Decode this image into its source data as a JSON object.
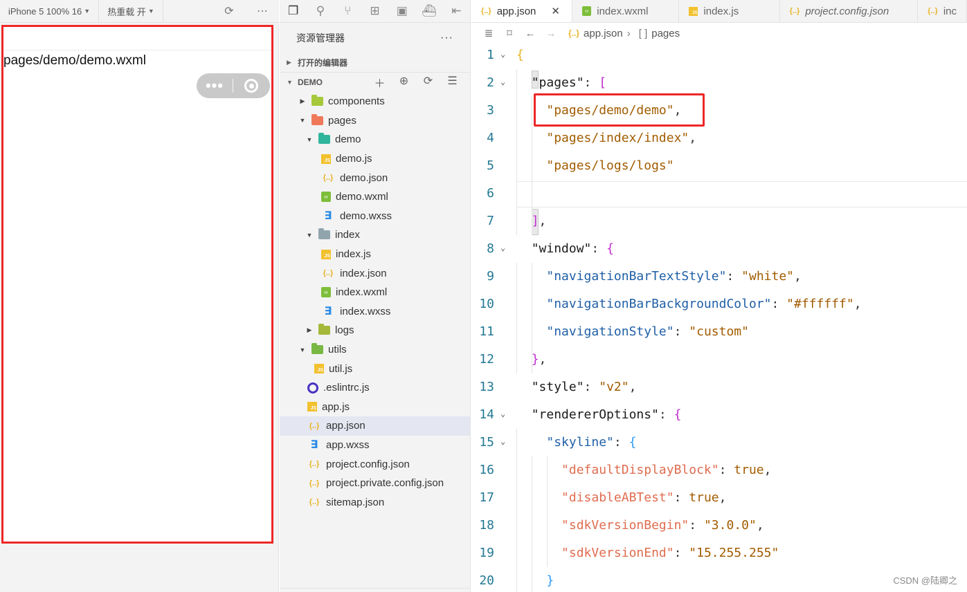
{
  "simulator": {
    "device_label": "iPhone 5 100% 16",
    "hot_reload_label": "热重载 开",
    "page_path": "pages/demo/demo.wxml"
  },
  "explorer": {
    "title": "资源管理器",
    "open_editors": "打开的编辑器",
    "project": "DEMO",
    "tree": [
      {
        "label": "components",
        "type": "folder",
        "depth": 1,
        "expanded": false,
        "color": "#a5c93a"
      },
      {
        "label": "pages",
        "type": "folder",
        "depth": 1,
        "expanded": true,
        "color": "#f0795a"
      },
      {
        "label": "demo",
        "type": "folder",
        "depth": 2,
        "expanded": true,
        "color": "#2fb59b"
      },
      {
        "label": "demo.js",
        "type": "js",
        "depth": 3
      },
      {
        "label": "demo.json",
        "type": "json",
        "depth": 3
      },
      {
        "label": "demo.wxml",
        "type": "wxml",
        "depth": 3
      },
      {
        "label": "demo.wxss",
        "type": "wxss",
        "depth": 3
      },
      {
        "label": "index",
        "type": "folder",
        "depth": 2,
        "expanded": true,
        "color": "#90a4ae"
      },
      {
        "label": "index.js",
        "type": "js",
        "depth": 3
      },
      {
        "label": "index.json",
        "type": "json",
        "depth": 3
      },
      {
        "label": "index.wxml",
        "type": "wxml",
        "depth": 3
      },
      {
        "label": "index.wxss",
        "type": "wxss",
        "depth": 3
      },
      {
        "label": "logs",
        "type": "folder",
        "depth": 2,
        "expanded": false,
        "color": "#a5b83a"
      },
      {
        "label": "utils",
        "type": "folder",
        "depth": 1,
        "expanded": true,
        "color": "#78b843"
      },
      {
        "label": "util.js",
        "type": "js",
        "depth": 2
      },
      {
        "label": ".eslintrc.js",
        "type": "eslint",
        "depth": 1
      },
      {
        "label": "app.js",
        "type": "js",
        "depth": 1
      },
      {
        "label": "app.json",
        "type": "json",
        "depth": 1,
        "selected": true
      },
      {
        "label": "app.wxss",
        "type": "wxss",
        "depth": 1
      },
      {
        "label": "project.config.json",
        "type": "json",
        "depth": 1
      },
      {
        "label": "project.private.config.json",
        "type": "json",
        "depth": 1
      },
      {
        "label": "sitemap.json",
        "type": "json",
        "depth": 1
      }
    ]
  },
  "editor": {
    "tabs": [
      {
        "label": "app.json",
        "icon": "json",
        "active": true,
        "close": "✕"
      },
      {
        "label": "index.wxml",
        "icon": "wxml"
      },
      {
        "label": "index.js",
        "icon": "js"
      },
      {
        "label": "project.config.json",
        "icon": "json",
        "italic": true
      },
      {
        "label": "inc",
        "icon": "json"
      }
    ],
    "breadcrumb": {
      "file": "app.json",
      "node": "pages"
    },
    "lines": [
      {
        "n": "1",
        "fold": true,
        "segs": [
          [
            "b1",
            "{"
          ]
        ]
      },
      {
        "n": "2",
        "fold": true,
        "segs": [
          [
            "p",
            "  "
          ],
          [
            "k1",
            "\"pages\""
          ],
          [
            "p",
            ": "
          ],
          [
            "b2",
            "["
          ]
        ]
      },
      {
        "n": "3",
        "segs": [
          [
            "p",
            "    "
          ],
          [
            "s1",
            "\"pages/demo/demo\""
          ],
          [
            "p",
            ","
          ]
        ]
      },
      {
        "n": "4",
        "segs": [
          [
            "p",
            "    "
          ],
          [
            "s1",
            "\"pages/index/index\""
          ],
          [
            "p",
            ","
          ]
        ]
      },
      {
        "n": "5",
        "segs": [
          [
            "p",
            "    "
          ],
          [
            "s1",
            "\"pages/logs/logs\""
          ]
        ]
      },
      {
        "n": "6",
        "segs": []
      },
      {
        "n": "7",
        "segs": [
          [
            "p",
            "  "
          ],
          [
            "b2",
            "]"
          ],
          [
            "p",
            ","
          ]
        ]
      },
      {
        "n": "8",
        "fold": true,
        "segs": [
          [
            "p",
            "  "
          ],
          [
            "k1",
            "\"window\""
          ],
          [
            "p",
            ": "
          ],
          [
            "b2",
            "{"
          ]
        ]
      },
      {
        "n": "9",
        "segs": [
          [
            "p",
            "    "
          ],
          [
            "k2",
            "\"navigationBarTextStyle\""
          ],
          [
            "p",
            ": "
          ],
          [
            "kw",
            "\"white\""
          ],
          [
            "p",
            ","
          ]
        ]
      },
      {
        "n": "10",
        "segs": [
          [
            "p",
            "    "
          ],
          [
            "k2",
            "\"navigationBarBackgroundColor\""
          ],
          [
            "p",
            ": "
          ],
          [
            "kw",
            "\"#ffffff\""
          ],
          [
            "p",
            ","
          ]
        ]
      },
      {
        "n": "11",
        "segs": [
          [
            "p",
            "    "
          ],
          [
            "k2",
            "\"navigationStyle\""
          ],
          [
            "p",
            ": "
          ],
          [
            "kw",
            "\"custom\""
          ]
        ]
      },
      {
        "n": "12",
        "segs": [
          [
            "p",
            "  "
          ],
          [
            "b2",
            "}"
          ],
          [
            "p",
            ","
          ]
        ]
      },
      {
        "n": "13",
        "segs": [
          [
            "p",
            "  "
          ],
          [
            "k1",
            "\"style\""
          ],
          [
            "p",
            ": "
          ],
          [
            "kw",
            "\"v2\""
          ],
          [
            "p",
            ","
          ]
        ]
      },
      {
        "n": "14",
        "fold": true,
        "segs": [
          [
            "p",
            "  "
          ],
          [
            "k1",
            "\"rendererOptions\""
          ],
          [
            "p",
            ": "
          ],
          [
            "b2",
            "{"
          ]
        ]
      },
      {
        "n": "15",
        "fold": true,
        "segs": [
          [
            "p",
            "    "
          ],
          [
            "k2",
            "\"skyline\""
          ],
          [
            "p",
            ": "
          ],
          [
            "b3",
            "{"
          ]
        ]
      },
      {
        "n": "16",
        "segs": [
          [
            "p",
            "      "
          ],
          [
            "k3",
            "\"defaultDisplayBlock\""
          ],
          [
            "p",
            ": "
          ],
          [
            "kw",
            "true"
          ],
          [
            "p",
            ","
          ]
        ]
      },
      {
        "n": "17",
        "segs": [
          [
            "p",
            "      "
          ],
          [
            "k3",
            "\"disableABTest\""
          ],
          [
            "p",
            ": "
          ],
          [
            "kw",
            "true"
          ],
          [
            "p",
            ","
          ]
        ]
      },
      {
        "n": "18",
        "segs": [
          [
            "p",
            "      "
          ],
          [
            "k3",
            "\"sdkVersionBegin\""
          ],
          [
            "p",
            ": "
          ],
          [
            "kw",
            "\"3.0.0\""
          ],
          [
            "p",
            ","
          ]
        ]
      },
      {
        "n": "19",
        "segs": [
          [
            "p",
            "      "
          ],
          [
            "k3",
            "\"sdkVersionEnd\""
          ],
          [
            "p",
            ": "
          ],
          [
            "kw",
            "\"15.255.255\""
          ]
        ]
      },
      {
        "n": "20",
        "segs": [
          [
            "p",
            "    "
          ],
          [
            "b3",
            "}"
          ]
        ]
      }
    ]
  },
  "watermark": "CSDN @陆卿之",
  "colors": {
    "highlight": "#ee2727",
    "selection": "#e4e6f1"
  }
}
